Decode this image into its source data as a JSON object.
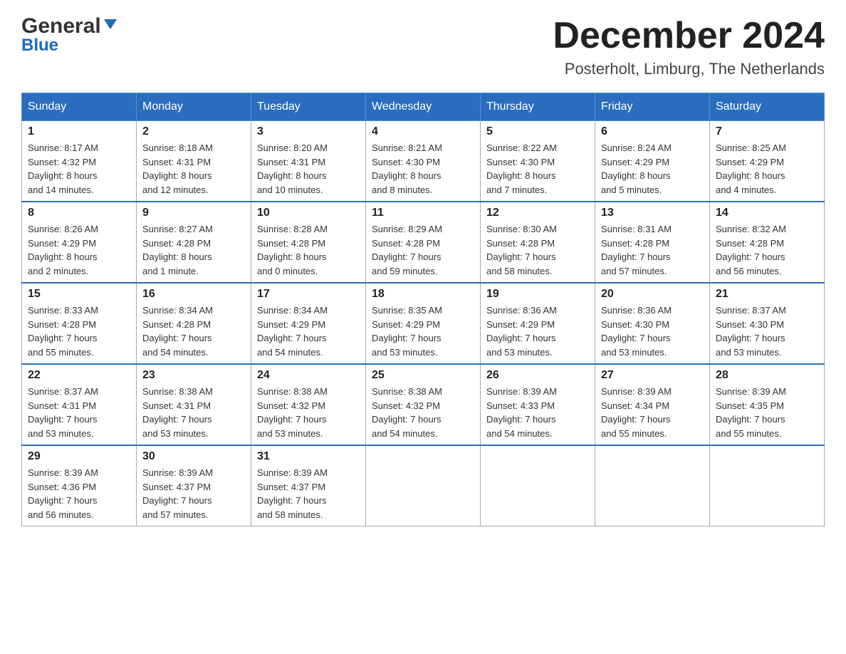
{
  "header": {
    "logo_general": "General",
    "logo_blue": "Blue",
    "month_title": "December 2024",
    "location": "Posterholt, Limburg, The Netherlands"
  },
  "days_of_week": [
    "Sunday",
    "Monday",
    "Tuesday",
    "Wednesday",
    "Thursday",
    "Friday",
    "Saturday"
  ],
  "weeks": [
    [
      {
        "day": "1",
        "sunrise": "8:17 AM",
        "sunset": "4:32 PM",
        "daylight": "8 hours and 14 minutes."
      },
      {
        "day": "2",
        "sunrise": "8:18 AM",
        "sunset": "4:31 PM",
        "daylight": "8 hours and 12 minutes."
      },
      {
        "day": "3",
        "sunrise": "8:20 AM",
        "sunset": "4:31 PM",
        "daylight": "8 hours and 10 minutes."
      },
      {
        "day": "4",
        "sunrise": "8:21 AM",
        "sunset": "4:30 PM",
        "daylight": "8 hours and 8 minutes."
      },
      {
        "day": "5",
        "sunrise": "8:22 AM",
        "sunset": "4:30 PM",
        "daylight": "8 hours and 7 minutes."
      },
      {
        "day": "6",
        "sunrise": "8:24 AM",
        "sunset": "4:29 PM",
        "daylight": "8 hours and 5 minutes."
      },
      {
        "day": "7",
        "sunrise": "8:25 AM",
        "sunset": "4:29 PM",
        "daylight": "8 hours and 4 minutes."
      }
    ],
    [
      {
        "day": "8",
        "sunrise": "8:26 AM",
        "sunset": "4:29 PM",
        "daylight": "8 hours and 2 minutes."
      },
      {
        "day": "9",
        "sunrise": "8:27 AM",
        "sunset": "4:28 PM",
        "daylight": "8 hours and 1 minute."
      },
      {
        "day": "10",
        "sunrise": "8:28 AM",
        "sunset": "4:28 PM",
        "daylight": "8 hours and 0 minutes."
      },
      {
        "day": "11",
        "sunrise": "8:29 AM",
        "sunset": "4:28 PM",
        "daylight": "7 hours and 59 minutes."
      },
      {
        "day": "12",
        "sunrise": "8:30 AM",
        "sunset": "4:28 PM",
        "daylight": "7 hours and 58 minutes."
      },
      {
        "day": "13",
        "sunrise": "8:31 AM",
        "sunset": "4:28 PM",
        "daylight": "7 hours and 57 minutes."
      },
      {
        "day": "14",
        "sunrise": "8:32 AM",
        "sunset": "4:28 PM",
        "daylight": "7 hours and 56 minutes."
      }
    ],
    [
      {
        "day": "15",
        "sunrise": "8:33 AM",
        "sunset": "4:28 PM",
        "daylight": "7 hours and 55 minutes."
      },
      {
        "day": "16",
        "sunrise": "8:34 AM",
        "sunset": "4:28 PM",
        "daylight": "7 hours and 54 minutes."
      },
      {
        "day": "17",
        "sunrise": "8:34 AM",
        "sunset": "4:29 PM",
        "daylight": "7 hours and 54 minutes."
      },
      {
        "day": "18",
        "sunrise": "8:35 AM",
        "sunset": "4:29 PM",
        "daylight": "7 hours and 53 minutes."
      },
      {
        "day": "19",
        "sunrise": "8:36 AM",
        "sunset": "4:29 PM",
        "daylight": "7 hours and 53 minutes."
      },
      {
        "day": "20",
        "sunrise": "8:36 AM",
        "sunset": "4:30 PM",
        "daylight": "7 hours and 53 minutes."
      },
      {
        "day": "21",
        "sunrise": "8:37 AM",
        "sunset": "4:30 PM",
        "daylight": "7 hours and 53 minutes."
      }
    ],
    [
      {
        "day": "22",
        "sunrise": "8:37 AM",
        "sunset": "4:31 PM",
        "daylight": "7 hours and 53 minutes."
      },
      {
        "day": "23",
        "sunrise": "8:38 AM",
        "sunset": "4:31 PM",
        "daylight": "7 hours and 53 minutes."
      },
      {
        "day": "24",
        "sunrise": "8:38 AM",
        "sunset": "4:32 PM",
        "daylight": "7 hours and 53 minutes."
      },
      {
        "day": "25",
        "sunrise": "8:38 AM",
        "sunset": "4:32 PM",
        "daylight": "7 hours and 54 minutes."
      },
      {
        "day": "26",
        "sunrise": "8:39 AM",
        "sunset": "4:33 PM",
        "daylight": "7 hours and 54 minutes."
      },
      {
        "day": "27",
        "sunrise": "8:39 AM",
        "sunset": "4:34 PM",
        "daylight": "7 hours and 55 minutes."
      },
      {
        "day": "28",
        "sunrise": "8:39 AM",
        "sunset": "4:35 PM",
        "daylight": "7 hours and 55 minutes."
      }
    ],
    [
      {
        "day": "29",
        "sunrise": "8:39 AM",
        "sunset": "4:36 PM",
        "daylight": "7 hours and 56 minutes."
      },
      {
        "day": "30",
        "sunrise": "8:39 AM",
        "sunset": "4:37 PM",
        "daylight": "7 hours and 57 minutes."
      },
      {
        "day": "31",
        "sunrise": "8:39 AM",
        "sunset": "4:37 PM",
        "daylight": "7 hours and 58 minutes."
      },
      null,
      null,
      null,
      null
    ]
  ]
}
